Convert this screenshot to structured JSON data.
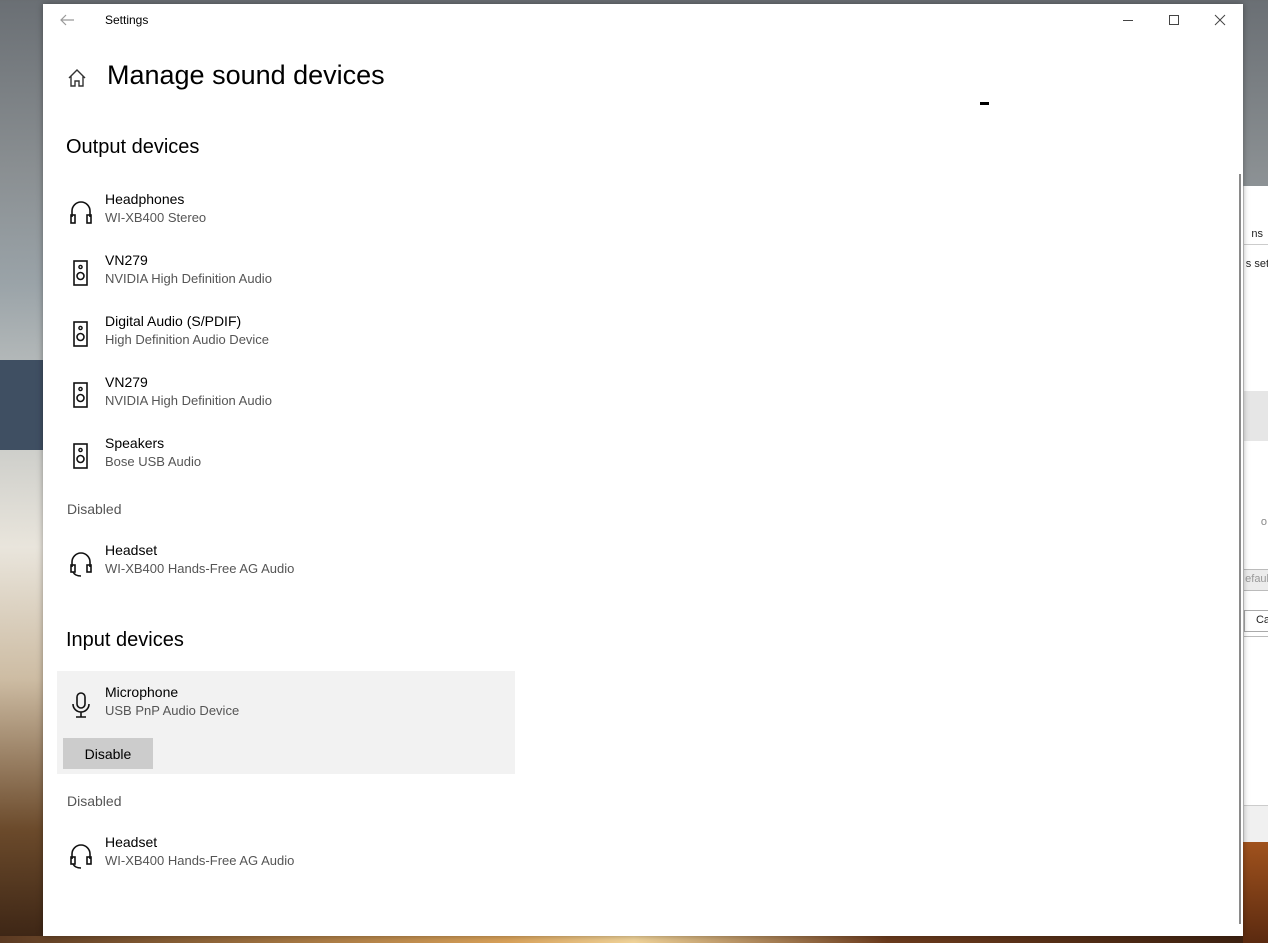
{
  "window": {
    "title": "Settings",
    "page_title": "Manage sound devices"
  },
  "output": {
    "heading": "Output devices",
    "devices": [
      {
        "name": "Headphones",
        "sub": "WI-XB400 Stereo",
        "icon": "headphones-icon"
      },
      {
        "name": "VN279",
        "sub": "NVIDIA High Definition Audio",
        "icon": "speaker-icon"
      },
      {
        "name": "Digital Audio (S/PDIF)",
        "sub": "High Definition Audio Device",
        "icon": "speaker-icon"
      },
      {
        "name": "VN279",
        "sub": "NVIDIA High Definition Audio",
        "icon": "speaker-icon"
      },
      {
        "name": "Speakers",
        "sub": "Bose USB Audio",
        "icon": "speaker-icon"
      }
    ],
    "disabled_label": "Disabled",
    "disabled_devices": [
      {
        "name": "Headset",
        "sub": "WI-XB400 Hands-Free AG Audio",
        "icon": "headset-icon"
      }
    ]
  },
  "input": {
    "heading": "Input devices",
    "devices": [
      {
        "name": "Microphone",
        "sub": "USB PnP Audio Device",
        "icon": "microphone-icon",
        "button": "Disable"
      }
    ],
    "disabled_label": "Disabled",
    "disabled_devices": [
      {
        "name": "Headset",
        "sub": "WI-XB400 Hands-Free AG Audio",
        "icon": "headset-icon"
      }
    ]
  },
  "background_window": {
    "fragments": [
      "ns",
      "s set",
      "o",
      "efaul",
      "Ca"
    ]
  }
}
